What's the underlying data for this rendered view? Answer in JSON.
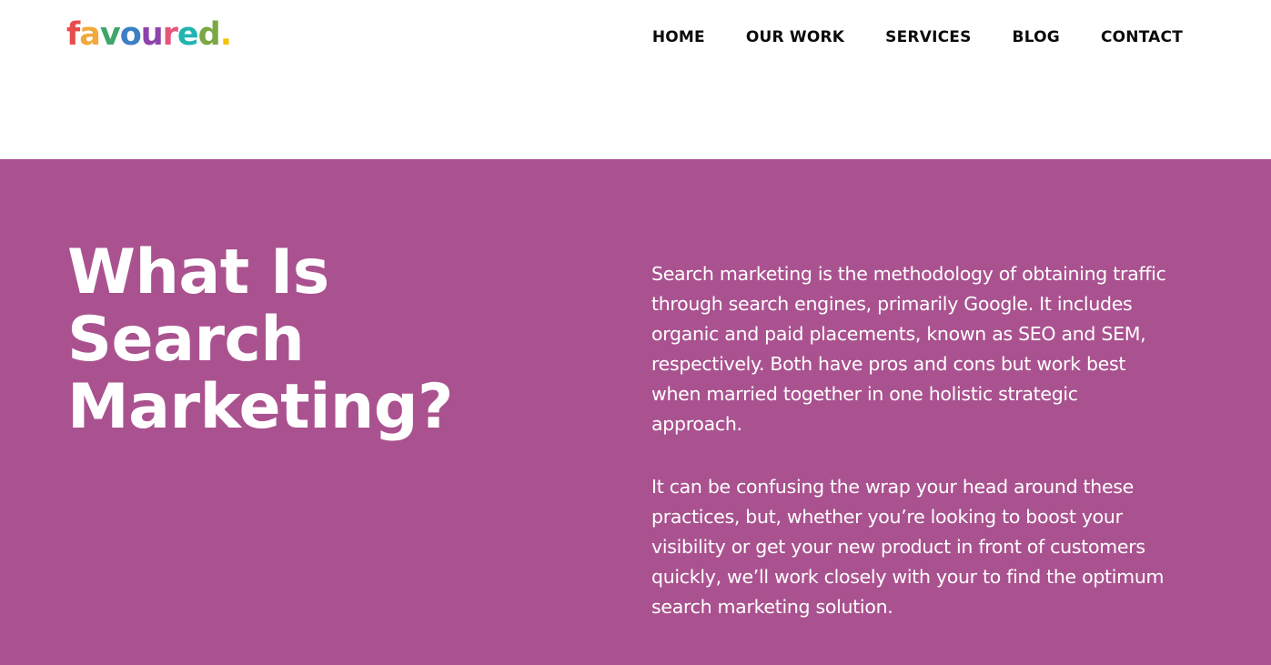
{
  "logo": {
    "letters": [
      {
        "char": "f",
        "color": "#e84c4c"
      },
      {
        "char": "a",
        "color": "#f2a93b"
      },
      {
        "char": "v",
        "color": "#3fa66b"
      },
      {
        "char": "o",
        "color": "#3b7fc4"
      },
      {
        "char": "u",
        "color": "#8e44ad"
      },
      {
        "char": "r",
        "color": "#e4567a"
      },
      {
        "char": "e",
        "color": "#1fb5b0"
      },
      {
        "char": "d",
        "color": "#7aa843"
      },
      {
        "char": ".",
        "color": "#f2c300"
      }
    ]
  },
  "nav": {
    "items": [
      {
        "label": "HOME"
      },
      {
        "label": "OUR WORK"
      },
      {
        "label": "SERVICES"
      },
      {
        "label": "BLOG"
      },
      {
        "label": "CONTACT"
      }
    ]
  },
  "hero": {
    "background": "#aa528f",
    "heading_lines": [
      "What Is",
      "Search",
      "Marketing?"
    ],
    "paragraphs": [
      "Search marketing is the methodology of obtaining traffic through search engines, primarily Google. It includes organic and paid placements, known as SEO and SEM, respectively. Both have pros and cons but work best when married together in one holistic strategic approach.",
      "It can be confusing the wrap your head around these practices, but, whether you’re looking to boost your visibility or get your new product in front of customers quickly, we’ll work closely with your to find the optimum search marketing solution."
    ]
  }
}
